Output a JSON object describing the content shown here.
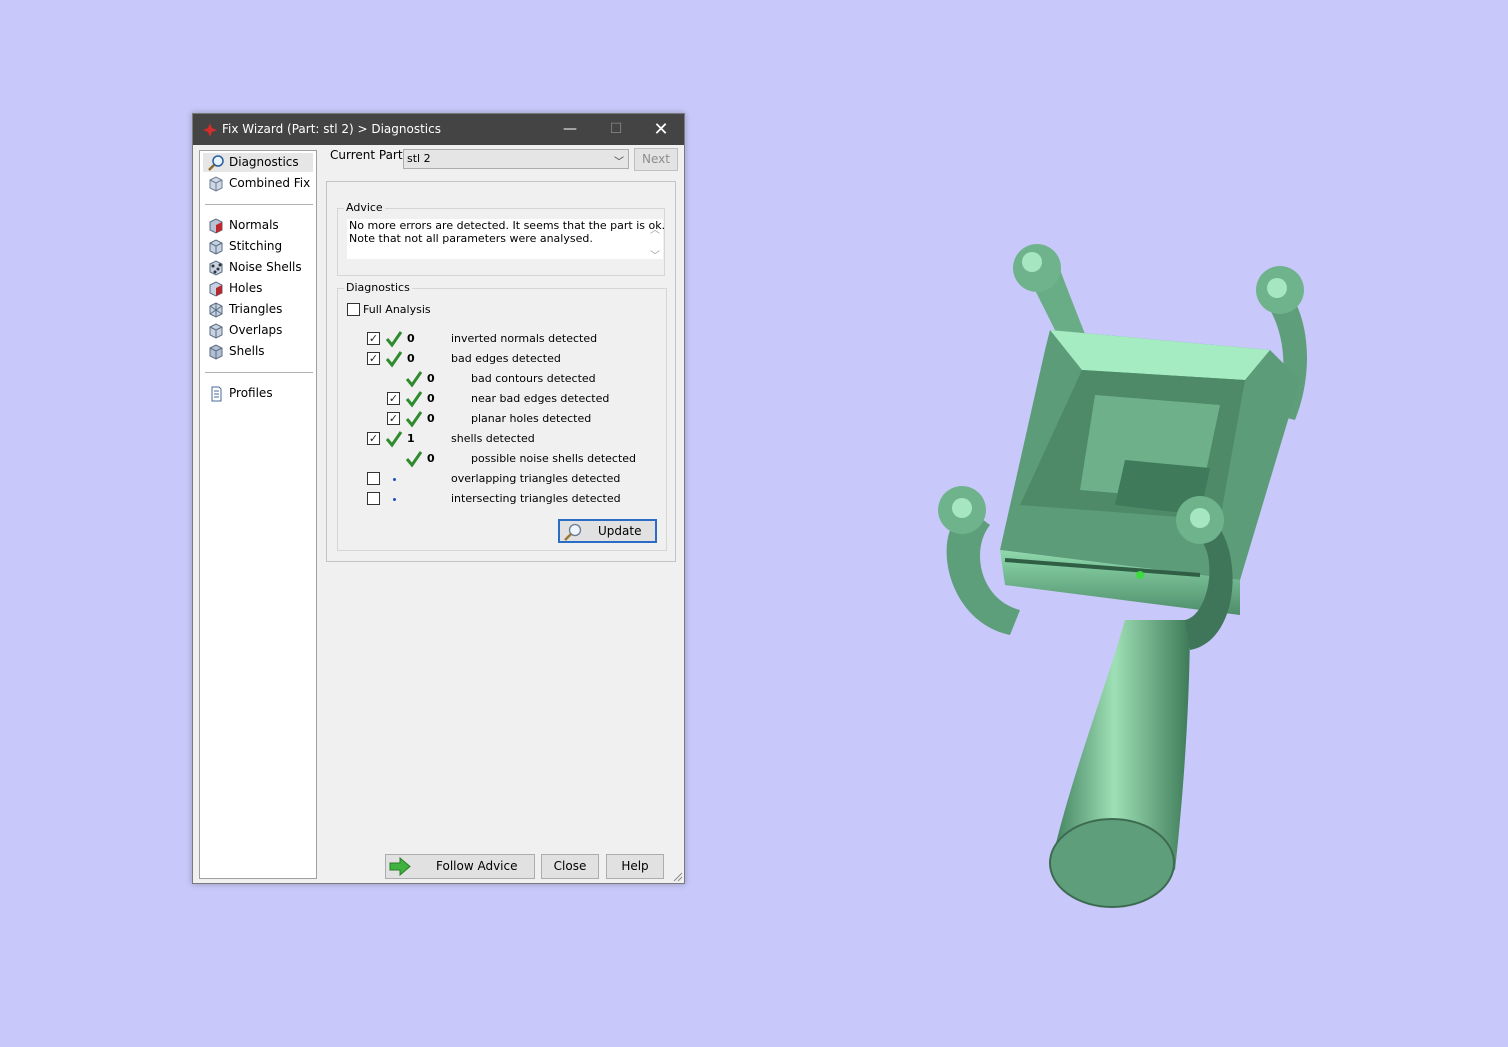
{
  "window": {
    "title": "Fix Wizard (Part: stl 2) > Diagnostics",
    "minimize": "—",
    "maximize": "☐",
    "close": "✕"
  },
  "sidebar": {
    "items": [
      {
        "label": "Diagnostics",
        "icon": "magnifier-icon"
      },
      {
        "label": "Combined Fix",
        "icon": "cube-icon"
      },
      {
        "label": "Normals",
        "icon": "normals-cube-icon"
      },
      {
        "label": "Stitching",
        "icon": "stitching-cube-icon"
      },
      {
        "label": "Noise Shells",
        "icon": "noise-shells-icon"
      },
      {
        "label": "Holes",
        "icon": "holes-cube-icon"
      },
      {
        "label": "Triangles",
        "icon": "triangles-cube-icon"
      },
      {
        "label": "Overlaps",
        "icon": "overlaps-cube-icon"
      },
      {
        "label": "Shells",
        "icon": "shells-cube-icon"
      },
      {
        "label": "Profiles",
        "icon": "document-icon"
      }
    ]
  },
  "header": {
    "current_part_label": "Current Part:",
    "current_part_value": "stl 2",
    "next_label": "Next"
  },
  "advice": {
    "title": "Advice",
    "lines": [
      "No more errors are detected. It seems that the part is ok.",
      "Note that not all parameters were analysed."
    ]
  },
  "diagnostics": {
    "title": "Diagnostics",
    "full_analysis_label": "Full Analysis",
    "rows": [
      {
        "checkbox": true,
        "checked": true,
        "status": "ok",
        "value": "0",
        "label": "inverted normals detected"
      },
      {
        "checkbox": true,
        "checked": true,
        "status": "ok",
        "value": "0",
        "label": "bad edges detected"
      },
      {
        "checkbox": false,
        "checked": false,
        "status": "ok",
        "value": "0",
        "label": "bad contours detected"
      },
      {
        "checkbox": true,
        "checked": true,
        "status": "ok",
        "value": "0",
        "label": "near bad edges detected"
      },
      {
        "checkbox": true,
        "checked": true,
        "status": "ok",
        "value": "0",
        "label": "planar holes detected"
      },
      {
        "checkbox": true,
        "checked": true,
        "status": "ok",
        "value": "1",
        "label": "shells detected"
      },
      {
        "checkbox": false,
        "checked": false,
        "status": "ok",
        "value": "0",
        "label": "possible noise shells detected"
      },
      {
        "checkbox": true,
        "checked": false,
        "status": "pending",
        "value": "",
        "label": "overlapping triangles detected"
      },
      {
        "checkbox": true,
        "checked": false,
        "status": "pending",
        "value": "",
        "label": "intersecting triangles detected"
      }
    ],
    "update_label": "Update"
  },
  "footer": {
    "follow_advice_label": "Follow Advice",
    "close_label": "Close",
    "help_label": "Help"
  },
  "colors": {
    "background": "#c8c8fa",
    "model": "#5fa27d",
    "titlebar": "#444444",
    "check": "#2e8b2e"
  }
}
